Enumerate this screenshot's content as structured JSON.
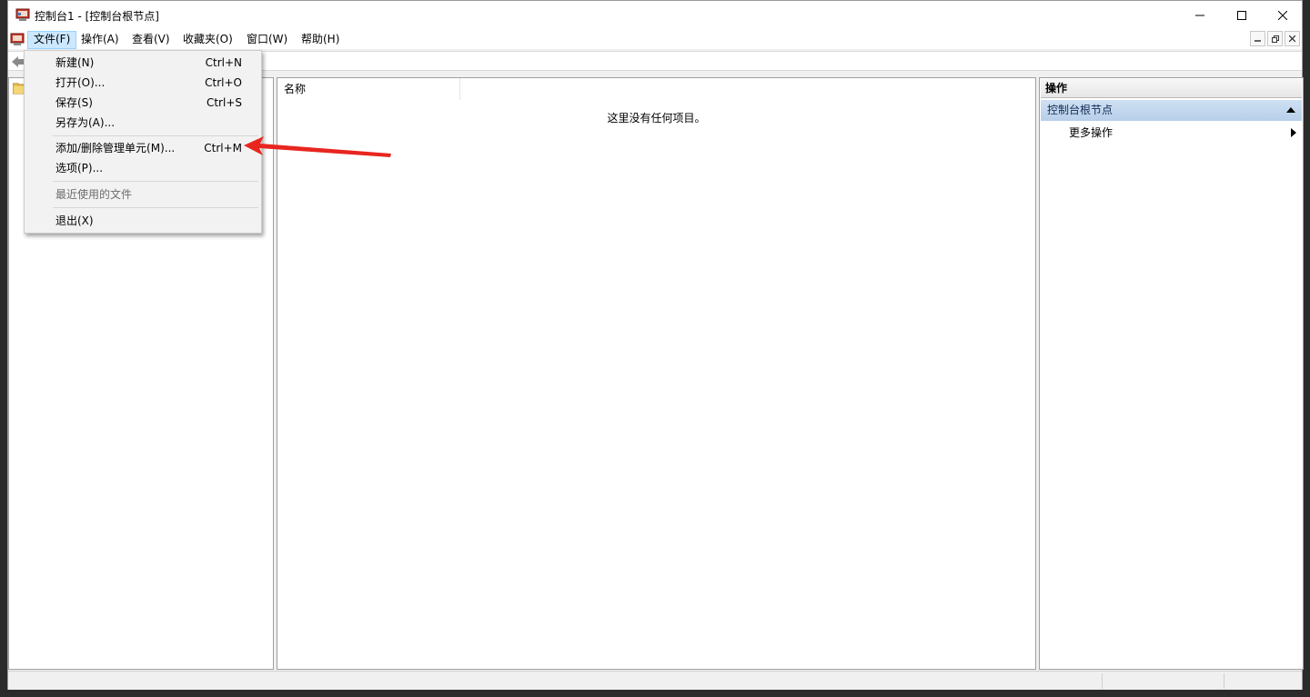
{
  "window": {
    "title": "控制台1 - [控制台根节点]"
  },
  "menubar": {
    "items": [
      "文件(F)",
      "操作(A)",
      "查看(V)",
      "收藏夹(O)",
      "窗口(W)",
      "帮助(H)"
    ]
  },
  "file_menu": {
    "items": [
      {
        "label": "新建(N)",
        "shortcut": "Ctrl+N"
      },
      {
        "label": "打开(O)...",
        "shortcut": "Ctrl+O"
      },
      {
        "label": "保存(S)",
        "shortcut": "Ctrl+S"
      },
      {
        "label": "另存为(A)...",
        "shortcut": ""
      },
      {
        "label": "添加/删除管理单元(M)...",
        "shortcut": "Ctrl+M"
      },
      {
        "label": "选项(P)...",
        "shortcut": ""
      },
      {
        "label": "最近使用的文件",
        "shortcut": ""
      },
      {
        "label": "退出(X)",
        "shortcut": ""
      }
    ]
  },
  "list_pane": {
    "column_header": "名称",
    "empty_message": "这里没有任何项目。"
  },
  "actions_pane": {
    "header": "操作",
    "group_title": "控制台根节点",
    "more_actions": "更多操作"
  },
  "colors": {
    "menu_highlight": "#cce8ff",
    "actions_group_bg": "#b7cfea",
    "annotation_arrow": "#e8261f"
  },
  "icons": {
    "app": "mmc-console-icon",
    "back": "back-arrow-icon",
    "folder": "folder-icon",
    "minimize": "minimize-icon",
    "maximize": "maximize-icon",
    "close": "close-icon"
  }
}
